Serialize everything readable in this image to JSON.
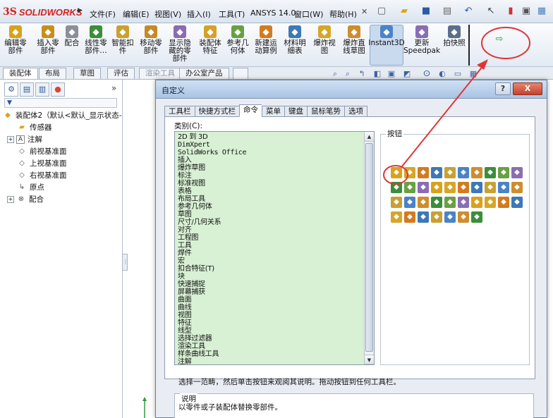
{
  "app": {
    "logo_mark": "3S",
    "logo_text": "SOLIDWORKS",
    "menu": [
      "文件(F)",
      "编辑(E)",
      "视图(V)",
      "插入(I)",
      "工具(T)",
      "ANSYS 14.0",
      "窗口(W)",
      "帮助(H)"
    ],
    "menu_pin": "✕"
  },
  "command_manager": {
    "buttons": [
      {
        "label": "编辑零\n部件",
        "icon": "edit-component-icon",
        "color": "#d9a21b"
      },
      {
        "label": "插入零\n部件",
        "icon": "insert-component-icon",
        "color": "#c98e1a"
      },
      {
        "label": "配合",
        "icon": "mate-icon",
        "color": "#8a8f99"
      },
      {
        "label": "线性零\n部件…",
        "icon": "linear-pattern-icon",
        "color": "#3c8e3a"
      },
      {
        "label": "智能扣\n件",
        "icon": "smart-fasteners-icon",
        "color": "#c9a032"
      },
      {
        "label": "移动零\n部件",
        "icon": "move-component-icon",
        "color": "#c48a2a"
      },
      {
        "label": "显示隐\n藏的零\n部件",
        "icon": "show-hidden-icon",
        "color": "#8d6bb0"
      },
      {
        "label": "装配体\n特征",
        "icon": "assembly-feature-icon",
        "color": "#d5a12a"
      },
      {
        "label": "参考几\n何体",
        "icon": "reference-geometry-icon",
        "color": "#68a043"
      },
      {
        "label": "新建运\n动算例",
        "icon": "motion-study-icon",
        "color": "#d37b1f"
      },
      {
        "label": "材料明\n细表",
        "icon": "bom-icon",
        "color": "#3f78b6"
      },
      {
        "label": "爆炸视\n图",
        "icon": "exploded-view-icon",
        "color": "#d6a628"
      },
      {
        "label": "爆炸直\n线草图",
        "icon": "explode-line-sketch-icon",
        "color": "#cf8d2e"
      },
      {
        "label": "Instant3D",
        "icon": "instant3d-icon",
        "color": "#4a83c7"
      },
      {
        "label": "更新\nSpeedpak",
        "icon": "speedpak-icon",
        "color": "#8a6db5"
      },
      {
        "label": "拍快照",
        "icon": "snapshot-icon",
        "color": "#5a6f8c"
      }
    ]
  },
  "tabs": {
    "items": [
      "装配体",
      "布局",
      "草图",
      "评估",
      "渲染工具",
      "办公室产品"
    ]
  },
  "feature_tree": {
    "filter": "▼",
    "root": "装配体2（默认<默认_显示状态-",
    "items": [
      "传感器",
      "注解",
      "前视基准面",
      "上视基准面",
      "右视基准面",
      "原点",
      "配合"
    ]
  },
  "dialog": {
    "title": "自定义",
    "help": "?",
    "close": "X",
    "tabs": [
      "工具栏",
      "快捷方式栏",
      "命令",
      "菜单",
      "键盘",
      "鼠标笔势",
      "选项"
    ],
    "active_tab": 2,
    "category_label": "类别(C):",
    "categories": [
      "2D 到 3D",
      "DimXpert",
      "SolidWorks Office",
      "插入",
      "爆炸草图",
      "标注",
      "标准视图",
      "表格",
      "布局工具",
      "参考几何体",
      "草图",
      "尺寸/几何关系",
      "对齐",
      "工程图",
      "工具",
      "焊件",
      "宏",
      "扣合特征(T)",
      "块",
      "快速捕捉",
      "屏幕捕获",
      "曲面",
      "曲线",
      "视图",
      "特征",
      "线型",
      "选择过滤器",
      "渲染工具",
      "样条曲线工具",
      "注解",
      "铸模工具",
      "装配体"
    ],
    "selected_category": "装配体",
    "buttons_label": "按钮",
    "hint": "选择一范畴，然后单击按钮来观阅其说明。拖动按钮到任何工具栏。",
    "desc_label": "说明",
    "desc_text": "以零件或子装配体替换零部件。"
  },
  "colors": {
    "annotation": "#e03535",
    "list_bg": "#d8f0d4",
    "selection": "#3b79d6"
  }
}
